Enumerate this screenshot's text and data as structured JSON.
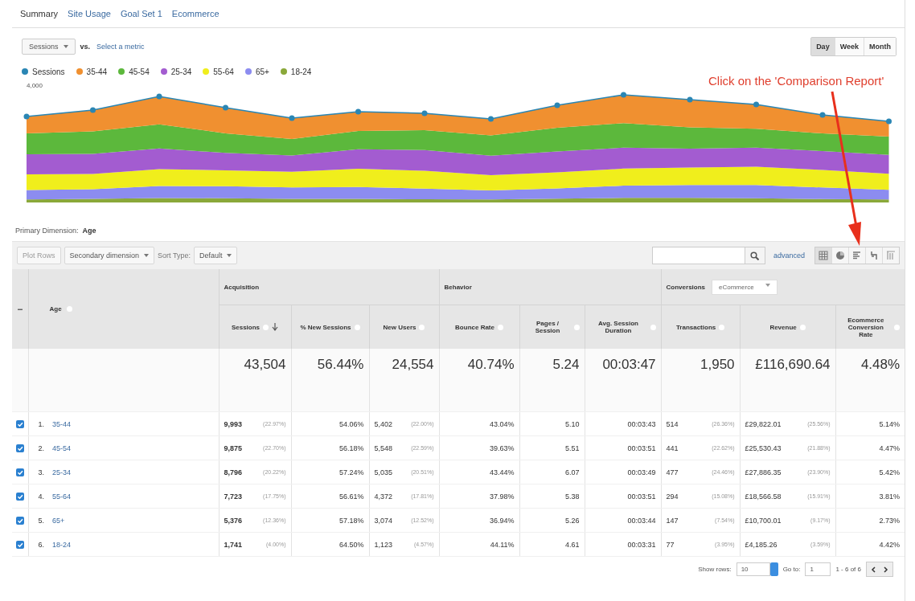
{
  "tabs": [
    {
      "label": "Summary",
      "selected": true
    },
    {
      "label": "Site Usage",
      "selected": false
    },
    {
      "label": "Goal Set 1",
      "selected": false
    },
    {
      "label": "Ecommerce",
      "selected": false
    }
  ],
  "chart_controls": {
    "metric": "Sessions",
    "vs": "vs.",
    "compare_link": "Select a metric",
    "periods": [
      {
        "label": "Day",
        "selected": true
      },
      {
        "label": "Week",
        "selected": false
      },
      {
        "label": "Month",
        "selected": false
      }
    ]
  },
  "legend": [
    {
      "label": "Sessions",
      "color": "#2a86b4"
    },
    {
      "label": "35-44",
      "color": "#f09030"
    },
    {
      "label": "45-54",
      "color": "#5cb83c"
    },
    {
      "label": "25-34",
      "color": "#a35cd0"
    },
    {
      "label": "55-64",
      "color": "#f0ee1c"
    },
    {
      "label": "65+",
      "color": "#8c8cf0"
    },
    {
      "label": "18-24",
      "color": "#8aa83a"
    }
  ],
  "chart": {
    "y_label": "4,000"
  },
  "annotation": {
    "text": "Click on the 'Comparison Report'"
  },
  "primary_dimension": {
    "label": "Primary Dimension:",
    "value": "Age"
  },
  "toolbar": {
    "plot_rows": "Plot Rows",
    "secondary": "Secondary dimension",
    "sort_label": "Sort Type:",
    "sort_value": "Default",
    "advanced": "advanced",
    "views": [
      {
        "kind": "table",
        "selected": true
      },
      {
        "kind": "pie",
        "selected": false
      },
      {
        "kind": "bars",
        "selected": false
      },
      {
        "kind": "comparison",
        "selected": false
      },
      {
        "kind": "pivot",
        "selected": false
      }
    ]
  },
  "table": {
    "collapse_symbol": "−",
    "age_header": "Age",
    "groups": [
      {
        "label": "Acquisition",
        "columns": [
          {
            "label": "Sessions",
            "sorted": true
          },
          {
            "label": "% New Sessions",
            "sorted": false
          },
          {
            "label": "New Users",
            "sorted": false
          }
        ]
      },
      {
        "label": "Behavior",
        "columns": [
          {
            "label": "Bounce Rate",
            "sorted": false
          },
          {
            "label": "Pages / Session",
            "sorted": false
          },
          {
            "label": "Avg. Session Duration",
            "sorted": false
          }
        ]
      },
      {
        "label": "Conversions",
        "dropdown": "eCommerce",
        "columns": [
          {
            "label": "Transactions",
            "sorted": false
          },
          {
            "label": "Revenue",
            "sorted": false
          },
          {
            "label": "Ecommerce Conversion Rate",
            "sorted": false
          }
        ]
      }
    ],
    "totals": [
      "43,504",
      "56.44%",
      "24,554",
      "40.74%",
      "5.24",
      "00:03:47",
      "1,950",
      "£116,690.64",
      "4.48%"
    ],
    "rows": [
      {
        "index": "1.",
        "age": "35-44",
        "checked": true,
        "cells": [
          {
            "value": "9,993",
            "share": "(22.97%)"
          },
          {
            "value": "54.06%"
          },
          {
            "value": "5,402",
            "share": "(22.00%)"
          },
          {
            "value": "43.04%"
          },
          {
            "value": "5.10"
          },
          {
            "value": "00:03:43"
          },
          {
            "value": "514",
            "share": "(26.36%)"
          },
          {
            "value": "£29,822.01",
            "share": "(25.56%)"
          },
          {
            "value": "5.14%"
          }
        ]
      },
      {
        "index": "2.",
        "age": "45-54",
        "checked": true,
        "cells": [
          {
            "value": "9,875",
            "share": "(22.70%)"
          },
          {
            "value": "56.18%"
          },
          {
            "value": "5,548",
            "share": "(22.59%)"
          },
          {
            "value": "39.63%"
          },
          {
            "value": "5.51"
          },
          {
            "value": "00:03:51"
          },
          {
            "value": "441",
            "share": "(22.62%)"
          },
          {
            "value": "£25,530.43",
            "share": "(21.88%)"
          },
          {
            "value": "4.47%"
          }
        ]
      },
      {
        "index": "3.",
        "age": "25-34",
        "checked": true,
        "cells": [
          {
            "value": "8,796",
            "share": "(20.22%)"
          },
          {
            "value": "57.24%"
          },
          {
            "value": "5,035",
            "share": "(20.51%)"
          },
          {
            "value": "43.44%"
          },
          {
            "value": "6.07"
          },
          {
            "value": "00:03:49"
          },
          {
            "value": "477",
            "share": "(24.46%)"
          },
          {
            "value": "£27,886.35",
            "share": "(23.90%)"
          },
          {
            "value": "5.42%"
          }
        ]
      },
      {
        "index": "4.",
        "age": "55-64",
        "checked": true,
        "cells": [
          {
            "value": "7,723",
            "share": "(17.75%)"
          },
          {
            "value": "56.61%"
          },
          {
            "value": "4,372",
            "share": "(17.81%)"
          },
          {
            "value": "37.98%"
          },
          {
            "value": "5.38"
          },
          {
            "value": "00:03:51"
          },
          {
            "value": "294",
            "share": "(15.08%)"
          },
          {
            "value": "£18,566.58",
            "share": "(15.91%)"
          },
          {
            "value": "3.81%"
          }
        ]
      },
      {
        "index": "5.",
        "age": "65+",
        "checked": true,
        "cells": [
          {
            "value": "5,376",
            "share": "(12.36%)"
          },
          {
            "value": "57.18%"
          },
          {
            "value": "3,074",
            "share": "(12.52%)"
          },
          {
            "value": "36.94%"
          },
          {
            "value": "5.26"
          },
          {
            "value": "00:03:44"
          },
          {
            "value": "147",
            "share": "(7.54%)"
          },
          {
            "value": "£10,700.01",
            "share": "(9.17%)"
          },
          {
            "value": "2.73%"
          }
        ]
      },
      {
        "index": "6.",
        "age": "18-24",
        "checked": true,
        "cells": [
          {
            "value": "1,741",
            "share": "(4.00%)"
          },
          {
            "value": "64.50%"
          },
          {
            "value": "1,123",
            "share": "(4.57%)"
          },
          {
            "value": "44.11%"
          },
          {
            "value": "4.61"
          },
          {
            "value": "00:03:31"
          },
          {
            "value": "77",
            "share": "(3.95%)"
          },
          {
            "value": "£4,185.26",
            "share": "(3.59%)"
          },
          {
            "value": "4.42%"
          }
        ]
      }
    ]
  },
  "footer": {
    "show_rows_label": "Show rows:",
    "show_rows": "10",
    "goto_label": "Go to:",
    "goto": "1",
    "range": "1 - 6 of 6"
  }
}
